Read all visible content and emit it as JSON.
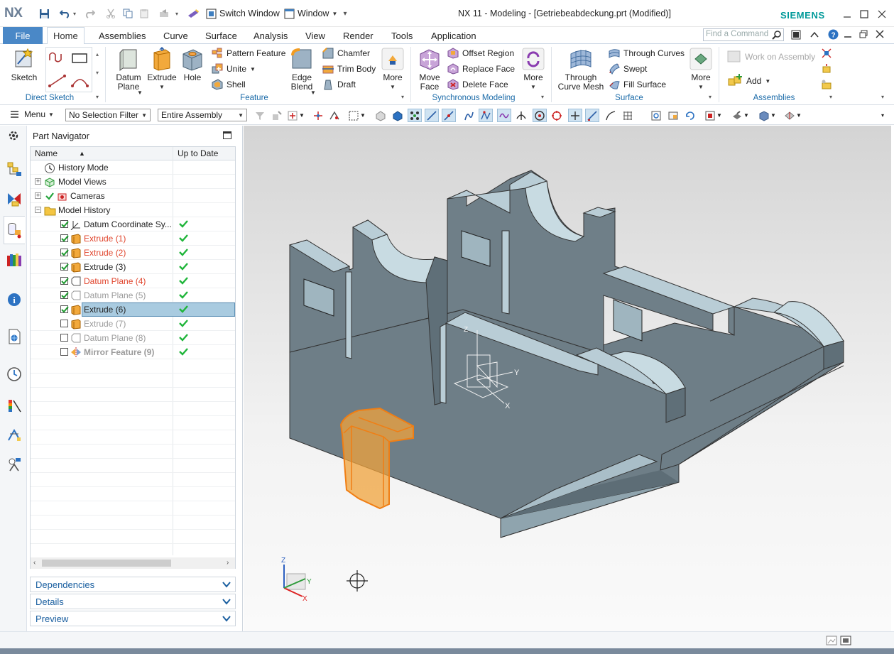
{
  "titlebar": {
    "app_logo": "NX",
    "switch_window": "Switch Window",
    "window_menu": "Window",
    "title": "NX 11 - Modeling - [Getriebeabdeckung.prt (Modified)]",
    "brand": "SIEMENS"
  },
  "tabs": {
    "file": "File",
    "items": [
      "Home",
      "Assemblies",
      "Curve",
      "Surface",
      "Analysis",
      "View",
      "Render",
      "Tools",
      "Application"
    ],
    "active": "Home",
    "find_placeholder": "Find a Command"
  },
  "ribbon": {
    "direct_sketch": {
      "sketch": "Sketch",
      "group": "Direct Sketch"
    },
    "feature": {
      "datum_plane": "Datum Plane",
      "extrude": "Extrude",
      "hole": "Hole",
      "pattern_feature": "Pattern Feature",
      "unite": "Unite",
      "shell": "Shell",
      "edge_blend": "Edge Blend",
      "chamfer": "Chamfer",
      "trim_body": "Trim Body",
      "draft": "Draft",
      "more": "More",
      "group": "Feature"
    },
    "sync": {
      "move_face": "Move Face",
      "offset_region": "Offset Region",
      "replace_face": "Replace Face",
      "delete_face": "Delete Face",
      "more": "More",
      "group": "Synchronous Modeling"
    },
    "surface": {
      "through_curve_mesh": "Through Curve Mesh",
      "through_curves": "Through Curves",
      "swept": "Swept",
      "fill_surface": "Fill Surface",
      "more": "More",
      "group": "Surface"
    },
    "assemblies": {
      "work_on_assembly": "Work on Assembly",
      "add": "Add",
      "group": "Assemblies"
    }
  },
  "toolbar2": {
    "menu": "Menu",
    "selection_filter": "No Selection Filter",
    "scope": "Entire Assembly"
  },
  "navigator": {
    "title": "Part Navigator",
    "col_name": "Name",
    "col_uptodate": "Up to Date",
    "rows": [
      {
        "label": "History Mode",
        "color": "#222"
      },
      {
        "label": "Model Views",
        "color": "#222"
      },
      {
        "label": "Cameras",
        "color": "#222"
      },
      {
        "label": "Model History",
        "color": "#222"
      },
      {
        "label": "Datum Coordinate Sy...",
        "color": "#222"
      },
      {
        "label": "Extrude (1)",
        "color": "#e0442c"
      },
      {
        "label": "Extrude (2)",
        "color": "#e0442c"
      },
      {
        "label": "Extrude (3)",
        "color": "#222"
      },
      {
        "label": "Datum Plane (4)",
        "color": "#e0442c"
      },
      {
        "label": "Datum Plane (5)",
        "color": "#9a9a9a"
      },
      {
        "label": "Extrude (6)",
        "color": "#222"
      },
      {
        "label": "Extrude (7)",
        "color": "#9a9a9a"
      },
      {
        "label": "Datum Plane (8)",
        "color": "#9a9a9a"
      },
      {
        "label": "Mirror Feature (9)",
        "color": "#9a9a9a"
      }
    ],
    "panels": [
      "Dependencies",
      "Details",
      "Preview"
    ]
  },
  "viewport": {
    "axis_labels": {
      "z": "Z",
      "y": "Y",
      "x": "X"
    },
    "triad_labels": {
      "z": "Z",
      "y": "Y",
      "x": "X"
    }
  },
  "colors": {
    "accent": "#4a88c7",
    "brand": "#009999",
    "model_face": "#6f7f87",
    "model_top": "#b9cdd6",
    "highlight": "#f5a347",
    "selected_row": "#a9cbe0"
  }
}
